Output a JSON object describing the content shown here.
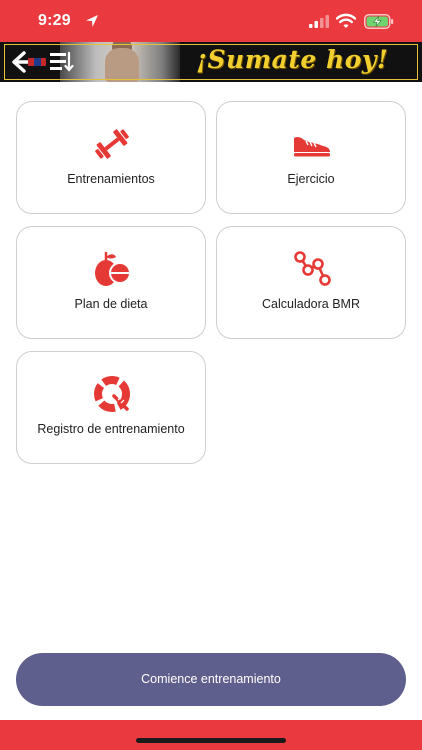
{
  "status_bar": {
    "time": "9:29",
    "location_icon": "location-arrow-icon",
    "signal_icon": "cellular-signal-icon",
    "wifi_icon": "wifi-icon",
    "battery_icon": "battery-charging-icon"
  },
  "banner": {
    "back_icon": "back-arrow-icon",
    "menu_icon": "list-menu-icon",
    "promo_text": "¡Sumate hoy!"
  },
  "menu": {
    "items": [
      {
        "label": "Entrenamientos",
        "icon": "dumbbell-icon"
      },
      {
        "label": "Ejercicio",
        "icon": "sneaker-icon"
      },
      {
        "label": "Plan de dieta",
        "icon": "fruit-bowl-icon"
      },
      {
        "label": "Calculadora BMR",
        "icon": "network-graph-icon"
      },
      {
        "label": "Registro de entrenamiento",
        "icon": "progress-ring-icon"
      }
    ]
  },
  "cta": {
    "label": "Comience entrenamiento"
  },
  "colors": {
    "accent_red": "#ea3a3f",
    "icon_red": "#e53935",
    "button_purple": "#5f5f8e",
    "banner_yellow": "#f1cf2f"
  }
}
